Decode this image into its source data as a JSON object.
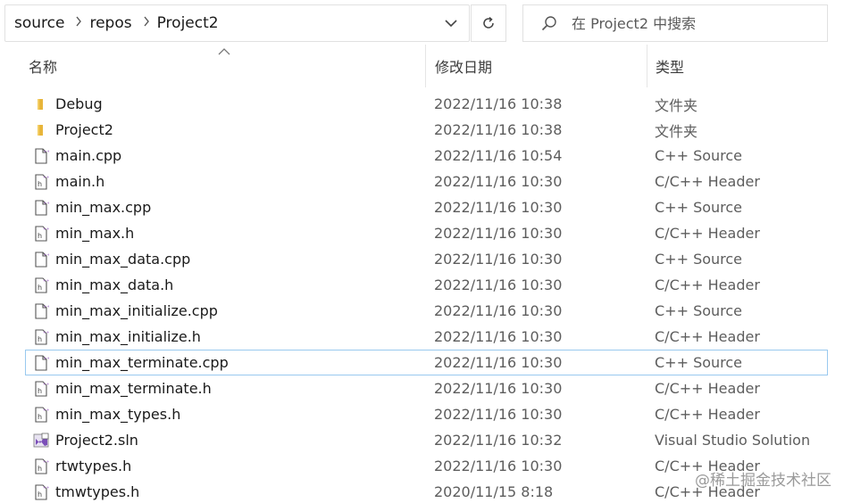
{
  "address_bar": {
    "breadcrumbs": [
      "source",
      "repos",
      "Project2"
    ]
  },
  "search": {
    "placeholder": "在 Project2 中搜索"
  },
  "columns": {
    "name": "名称",
    "date": "修改日期",
    "type": "类型"
  },
  "files": [
    {
      "name": "Debug",
      "date": "2022/11/16 10:38",
      "type": "文件夹",
      "icon": "folder-icon"
    },
    {
      "name": "Project2",
      "date": "2022/11/16 10:38",
      "type": "文件夹",
      "icon": "folder-icon"
    },
    {
      "name": "main.cpp",
      "date": "2022/11/16 10:54",
      "type": "C++ Source",
      "icon": "cpp-file-icon"
    },
    {
      "name": "main.h",
      "date": "2022/11/16 10:30",
      "type": "C/C++ Header",
      "icon": "header-file-icon"
    },
    {
      "name": "min_max.cpp",
      "date": "2022/11/16 10:30",
      "type": "C++ Source",
      "icon": "cpp-file-icon"
    },
    {
      "name": "min_max.h",
      "date": "2022/11/16 10:30",
      "type": "C/C++ Header",
      "icon": "header-file-icon"
    },
    {
      "name": "min_max_data.cpp",
      "date": "2022/11/16 10:30",
      "type": "C++ Source",
      "icon": "cpp-file-icon"
    },
    {
      "name": "min_max_data.h",
      "date": "2022/11/16 10:30",
      "type": "C/C++ Header",
      "icon": "header-file-icon"
    },
    {
      "name": "min_max_initialize.cpp",
      "date": "2022/11/16 10:30",
      "type": "C++ Source",
      "icon": "cpp-file-icon"
    },
    {
      "name": "min_max_initialize.h",
      "date": "2022/11/16 10:30",
      "type": "C/C++ Header",
      "icon": "header-file-icon"
    },
    {
      "name": "min_max_terminate.cpp",
      "date": "2022/11/16 10:30",
      "type": "C++ Source",
      "icon": "cpp-file-icon"
    },
    {
      "name": "min_max_terminate.h",
      "date": "2022/11/16 10:30",
      "type": "C/C++ Header",
      "icon": "header-file-icon"
    },
    {
      "name": "min_max_types.h",
      "date": "2022/11/16 10:30",
      "type": "C/C++ Header",
      "icon": "header-file-icon"
    },
    {
      "name": "Project2.sln",
      "date": "2022/11/16 10:32",
      "type": "Visual Studio Solution",
      "icon": "solution-file-icon"
    },
    {
      "name": "rtwtypes.h",
      "date": "2022/11/16 10:30",
      "type": "C/C++ Header",
      "icon": "header-file-icon"
    },
    {
      "name": "tmwtypes.h",
      "date": "2020/11/15 8:18",
      "type": "C/C++ Header",
      "icon": "header-file-icon"
    }
  ],
  "watermark": "@稀土掘金技术社区",
  "colors": {
    "folder": "#e8b53a",
    "focus_border": "#99c9ef",
    "solution_purple": "#7b4fb8"
  }
}
